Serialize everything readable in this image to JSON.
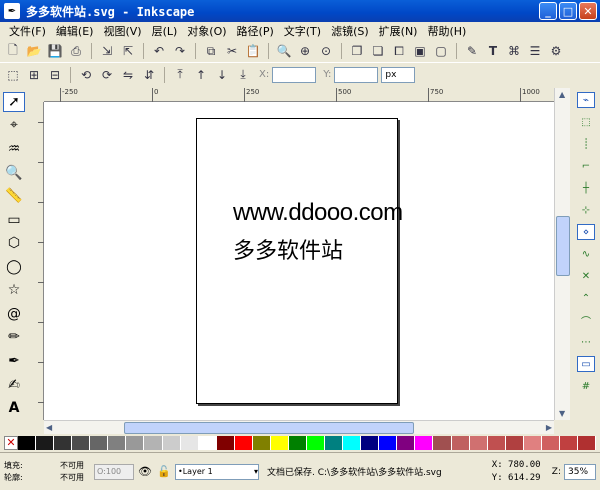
{
  "window": {
    "title": "多多软件站.svg - Inkscape",
    "minimize": "_",
    "maximize": "□",
    "close": "✕"
  },
  "menu": [
    "文件(F)",
    "编辑(E)",
    "视图(V)",
    "层(L)",
    "对象(O)",
    "路径(P)",
    "文字(T)",
    "滤镜(S)",
    "扩展(N)",
    "帮助(H)"
  ],
  "toolbar": {
    "x_label": "X:",
    "y_label": "Y:",
    "x_value": "",
    "y_value": "",
    "unit": "px"
  },
  "document": {
    "line1": "www.ddooo.com",
    "line2": "多多软件站"
  },
  "ruler": [
    "-250",
    "0",
    "250",
    "500",
    "750",
    "1000"
  ],
  "palette": [
    "#000000",
    "#1a1a1a",
    "#333333",
    "#4d4d4d",
    "#666666",
    "#808080",
    "#999999",
    "#b3b3b3",
    "#cccccc",
    "#e6e6e6",
    "#ffffff",
    "#800000",
    "#ff0000",
    "#808000",
    "#ffff00",
    "#008000",
    "#00ff00",
    "#008080",
    "#00ffff",
    "#000080",
    "#0000ff",
    "#800080",
    "#ff00ff",
    "#a05050",
    "#c06060",
    "#d07070",
    "#c05050",
    "#b04040",
    "#e08080",
    "#d06060",
    "#c04040",
    "#b03030"
  ],
  "status": {
    "fill_label": "填充:",
    "fill_value": "不可用",
    "stroke_label": "轮廓:",
    "stroke_value": "不可用",
    "opacity": "100",
    "layer": "•Layer 1",
    "message": "文档已保存. C:\\多多软件站\\多多软件站.svg",
    "x": "X:  780.00",
    "y": "Y:  614.29",
    "zoom_label": "Z:",
    "zoom": "35%"
  }
}
